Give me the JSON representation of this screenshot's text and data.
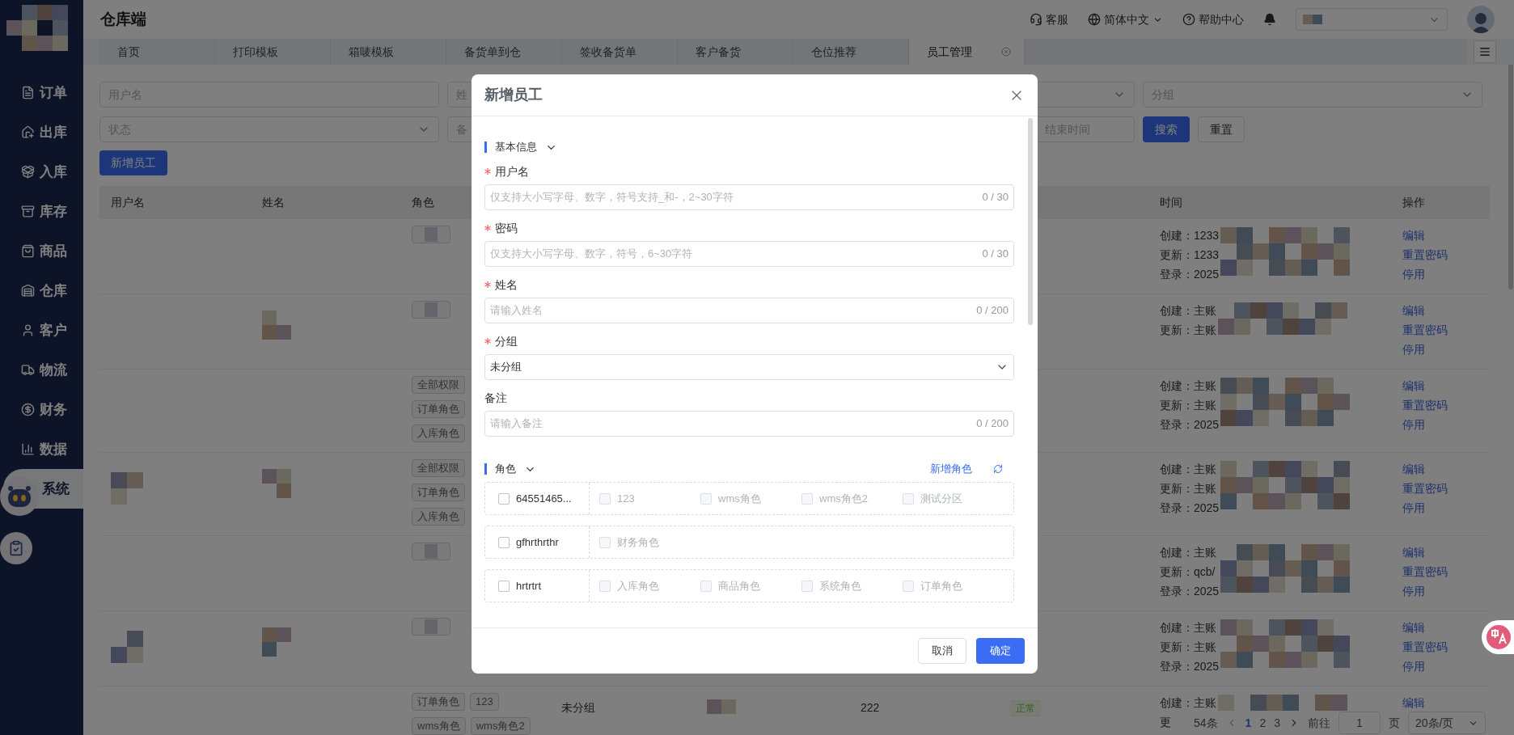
{
  "app": {
    "title": "仓库端"
  },
  "header": {
    "links": [
      {
        "label": "客服",
        "kind": "service"
      },
      {
        "label": "简体中文",
        "kind": "language"
      },
      {
        "label": "帮助中心",
        "kind": "help"
      }
    ]
  },
  "sidebar": {
    "items": [
      {
        "label": "订单",
        "kind": "order",
        "selected": false
      },
      {
        "label": "出库",
        "kind": "outbound",
        "selected": false
      },
      {
        "label": "入库",
        "kind": "inbound",
        "selected": false
      },
      {
        "label": "库存",
        "kind": "stock",
        "selected": false
      },
      {
        "label": "商品",
        "kind": "goods",
        "selected": false
      },
      {
        "label": "仓库",
        "kind": "warehouse",
        "selected": false
      },
      {
        "label": "客户",
        "kind": "customer",
        "selected": false
      },
      {
        "label": "物流",
        "kind": "logistics",
        "selected": false
      },
      {
        "label": "财务",
        "kind": "finance",
        "selected": false
      },
      {
        "label": "数据",
        "kind": "data",
        "selected": false
      },
      {
        "label": "系统",
        "kind": "system",
        "selected": true
      }
    ]
  },
  "tabs": [
    {
      "label": "首页",
      "selected": false,
      "closable": false
    },
    {
      "label": "打印模板",
      "selected": false,
      "closable": false
    },
    {
      "label": "箱唛模板",
      "selected": false,
      "closable": false
    },
    {
      "label": "备货单到仓",
      "selected": false,
      "closable": false
    },
    {
      "label": "签收备货单",
      "selected": false,
      "closable": false
    },
    {
      "label": "客户备货",
      "selected": false,
      "closable": false
    },
    {
      "label": "仓位推荐",
      "selected": false,
      "closable": false
    },
    {
      "label": "员工管理",
      "selected": true,
      "closable": true
    }
  ],
  "filters": [
    {
      "kind": "input",
      "placeholder": "用户名"
    },
    {
      "kind": "input",
      "placeholder": "姓"
    },
    {
      "kind": "select"
    },
    {
      "kind": "select",
      "placeholder": "分组"
    },
    {
      "kind": "select",
      "placeholder": "状态"
    },
    {
      "kind": "input",
      "placeholder": "备"
    },
    {
      "kind": "date_range",
      "placeholder": "结束时间"
    }
  ],
  "filter_buttons": [
    {
      "label": "搜索",
      "kind": "primary"
    },
    {
      "label": "重置",
      "kind": "default"
    }
  ],
  "add_button": {
    "label": "新增员工"
  },
  "table": {
    "columns": {
      "username": "用户名",
      "name": "姓名",
      "roles": "角色",
      "time": "时间",
      "actions": "操作"
    },
    "rows": [
      {
        "username_redacted": false,
        "name_redacted": false,
        "role_lines": [
          [
            {
              "kind": "redacted"
            }
          ]
        ],
        "time": [
          "创建：1233",
          "更新：1233",
          "登录：2025"
        ],
        "actions": [
          "编辑",
          "重置密码",
          "停用"
        ]
      },
      {
        "username_redacted": false,
        "name_redacted": true,
        "role_lines": [
          [
            {
              "kind": "redacted"
            }
          ]
        ],
        "time": [
          "创建：主账",
          "更新：主账"
        ],
        "actions": [
          "编辑",
          "重置密码",
          "停用"
        ]
      },
      {
        "username_redacted": false,
        "name_redacted": false,
        "role_lines": [
          [
            {
              "kind": "tag",
              "label": "全部权限"
            }
          ],
          [
            {
              "kind": "tag",
              "label": "订单角色"
            }
          ],
          [
            {
              "kind": "tag",
              "label": "入库角色"
            }
          ]
        ],
        "time": [
          "创建：主账",
          "更新：主账",
          "登录：2025"
        ],
        "actions": [
          "编辑",
          "重置密码",
          "停用"
        ]
      },
      {
        "username_redacted": true,
        "name_redacted": true,
        "role_lines": [
          [
            {
              "kind": "tag",
              "label": "全部权限"
            }
          ],
          [
            {
              "kind": "tag",
              "label": "订单角色"
            }
          ],
          [
            {
              "kind": "tag",
              "label": "入库角色"
            }
          ]
        ],
        "time": [
          "创建：主账",
          "更新：主账",
          "登录：2025"
        ],
        "actions": [
          "编辑",
          "重置密码",
          "停用"
        ]
      },
      {
        "username_redacted": false,
        "name_redacted": false,
        "role_lines": [
          [
            {
              "kind": "redacted"
            }
          ]
        ],
        "time": [
          "创建：主账",
          "更新：qcb/",
          "登录：2025"
        ],
        "actions": [
          "编辑",
          "重置密码",
          "停用"
        ]
      },
      {
        "username_redacted": true,
        "name_redacted": true,
        "role_lines": [
          [
            {
              "kind": "redacted"
            }
          ]
        ],
        "time": [
          "创建：主账",
          "更新：主账",
          "登录：2025"
        ],
        "actions": [
          "编辑",
          "重置密码",
          "停用"
        ]
      },
      {
        "username_redacted": false,
        "name_redacted": false,
        "role_lines": [
          [
            {
              "kind": "tag",
              "label": "订单角色"
            },
            {
              "kind": "tag",
              "label": "123"
            }
          ],
          [
            {
              "kind": "tag",
              "label": "wms角色"
            },
            {
              "kind": "tag",
              "label": "wms角色2"
            }
          ]
        ],
        "group": "未分组",
        "column_5_redacted": true,
        "column_6": "222",
        "status": "正常",
        "time": [
          "创建：主账",
          "更"
        ],
        "actions": [
          "编辑"
        ]
      }
    ]
  },
  "pagination": {
    "total": "54条",
    "pages": [
      {
        "label": "1",
        "selected": true
      },
      {
        "label": "2",
        "selected": false
      },
      {
        "label": "3",
        "selected": false
      }
    ],
    "goto_label": "前往",
    "goto_value": "1",
    "page_suffix": "页",
    "page_size": "20条/页"
  },
  "modal": {
    "title": "新增员工",
    "section": {
      "title": "基本信息",
      "expanded": true,
      "fields": [
        {
          "label": "用户名",
          "required": true,
          "kind": "input",
          "placeholder": "仅支持大小写字母、数字，符号支持_和-，2~30字符",
          "counter": "0 / 30"
        },
        {
          "label": "密码",
          "required": true,
          "kind": "input",
          "placeholder": "仅支持大小写字母、数字，符号，6~30字符",
          "counter": "0 / 30"
        },
        {
          "label": "姓名",
          "required": true,
          "kind": "input",
          "placeholder": "请输入姓名",
          "counter": "0 / 200"
        },
        {
          "label": "分组",
          "required": true,
          "kind": "select",
          "value": "未分组"
        },
        {
          "label": "备注",
          "required": false,
          "kind": "input",
          "placeholder": "请输入备注",
          "counter": "0 / 200"
        }
      ]
    },
    "roles": {
      "title": "角色",
      "expanded": true,
      "add_link": "新增角色",
      "groups": [
        {
          "label": "64551465...",
          "checked": false,
          "children": [
            {
              "label": "123",
              "checked": false,
              "disabled": true
            },
            {
              "label": "wms角色",
              "checked": false,
              "disabled": true
            },
            {
              "label": "wms角色2",
              "checked": false,
              "disabled": true
            },
            {
              "label": "测试分区",
              "checked": false,
              "disabled": true
            }
          ]
        },
        {
          "label": "gfhrthrthr",
          "checked": false,
          "children": [
            {
              "label": "财务角色",
              "checked": false,
              "disabled": true
            }
          ]
        },
        {
          "label": "hrtrtrt",
          "checked": false,
          "children": [
            {
              "label": "入库角色",
              "checked": false,
              "disabled": true
            },
            {
              "label": "商品角色",
              "checked": false,
              "disabled": true
            },
            {
              "label": "系统角色",
              "checked": false,
              "disabled": true
            },
            {
              "label": "订单角色",
              "checked": false,
              "disabled": true
            }
          ]
        }
      ]
    },
    "buttons": [
      {
        "label": "取消",
        "kind": "default"
      },
      {
        "label": "确定",
        "kind": "primary"
      }
    ]
  }
}
